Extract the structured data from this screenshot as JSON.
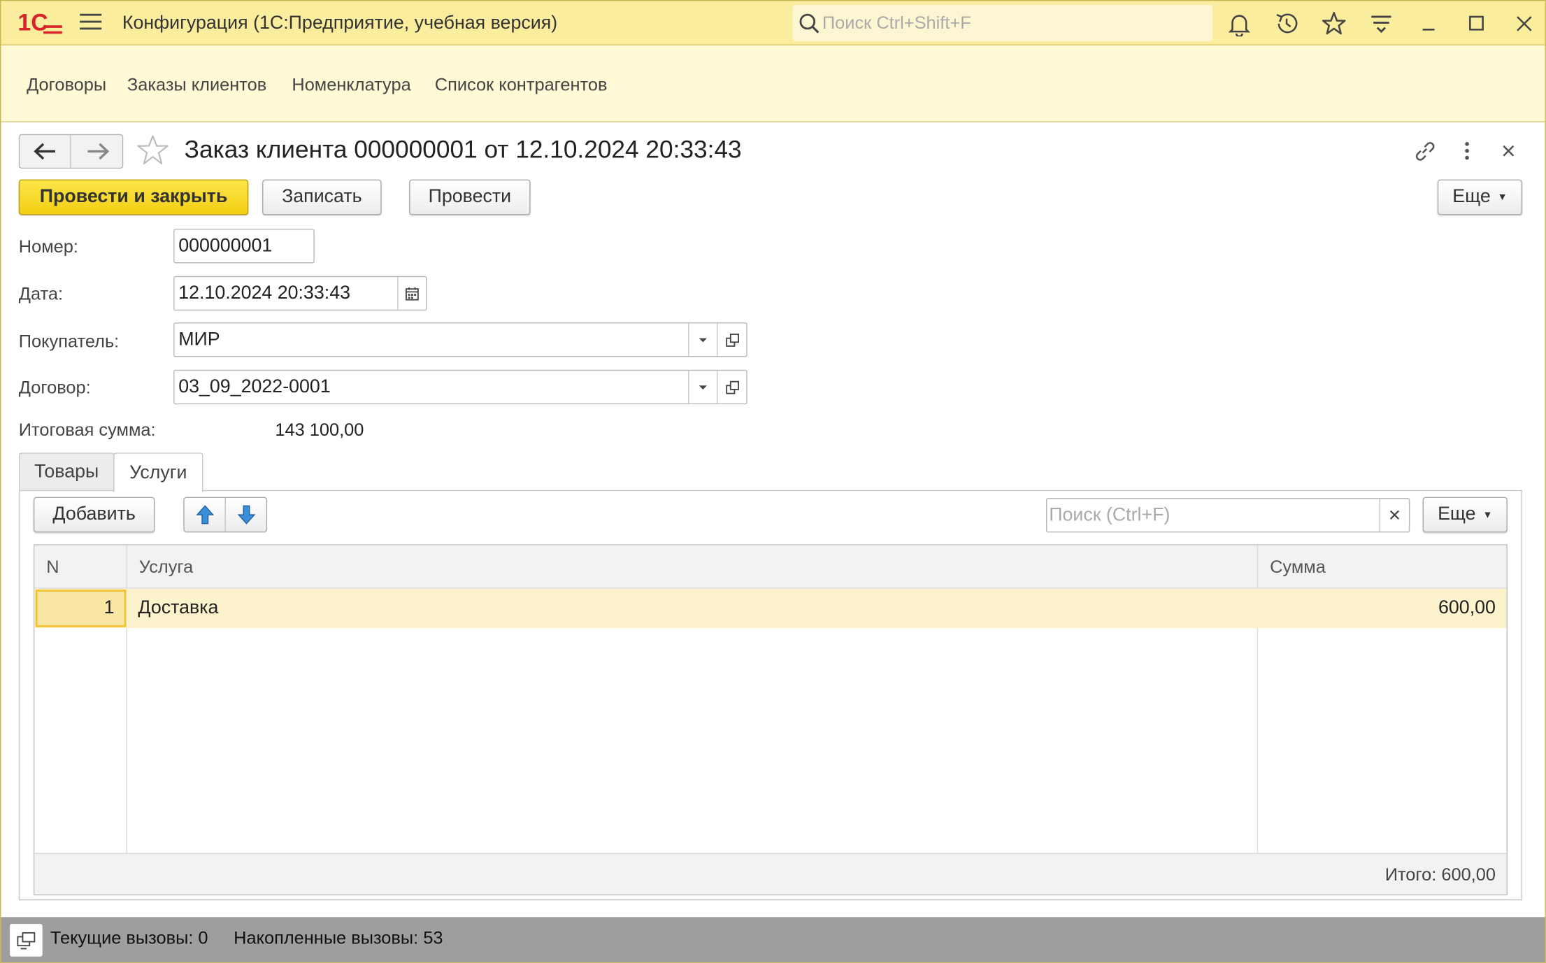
{
  "app": {
    "logo": "1С",
    "title": "Конфигурация  (1С:Предприятие, учебная версия)",
    "search_placeholder": "Поиск Ctrl+Shift+F"
  },
  "sections": [
    {
      "label": "Договоры"
    },
    {
      "label": "Заказы клиентов"
    },
    {
      "label": "Номенклатура"
    },
    {
      "label": "Список контрагентов"
    }
  ],
  "form": {
    "title": "Заказ клиента 000000001 от 12.10.2024 20:33:43",
    "buttons": {
      "post_close": "Провести и закрыть",
      "save": "Записать",
      "post": "Провести",
      "more": "Еще"
    },
    "fields": {
      "number_label": "Номер:",
      "number_value": "000000001",
      "date_label": "Дата:",
      "date_value": "12.10.2024 20:33:43",
      "buyer_label": "Покупатель:",
      "buyer_value": "МИР",
      "contract_label": "Договор:",
      "contract_value": "03_09_2022-0001",
      "total_label": "Итоговая сумма:",
      "total_value": "143 100,00"
    },
    "tabs": [
      {
        "label": "Товары",
        "active": false
      },
      {
        "label": "Услуги",
        "active": true
      }
    ]
  },
  "table": {
    "add_button": "Добавить",
    "search_placeholder": "Поиск (Ctrl+F)",
    "more": "Еще",
    "columns": [
      "N",
      "Услуга",
      "Сумма"
    ],
    "rows": [
      {
        "n": "1",
        "service": "Доставка",
        "sum": "600,00"
      }
    ],
    "footer_total": "Итого: 600,00"
  },
  "status": {
    "current_calls": "Текущие вызовы: 0",
    "accumulated_calls": "Накопленные вызовы: 53"
  },
  "colors": {
    "titlebar": "#fbed9e",
    "sections_bg": "#fff9d6",
    "primary_button": "#f2cf12",
    "selected_row": "#fcf2cc",
    "statusbar": "#9e9e9e",
    "logo_red": "#d8232a"
  }
}
